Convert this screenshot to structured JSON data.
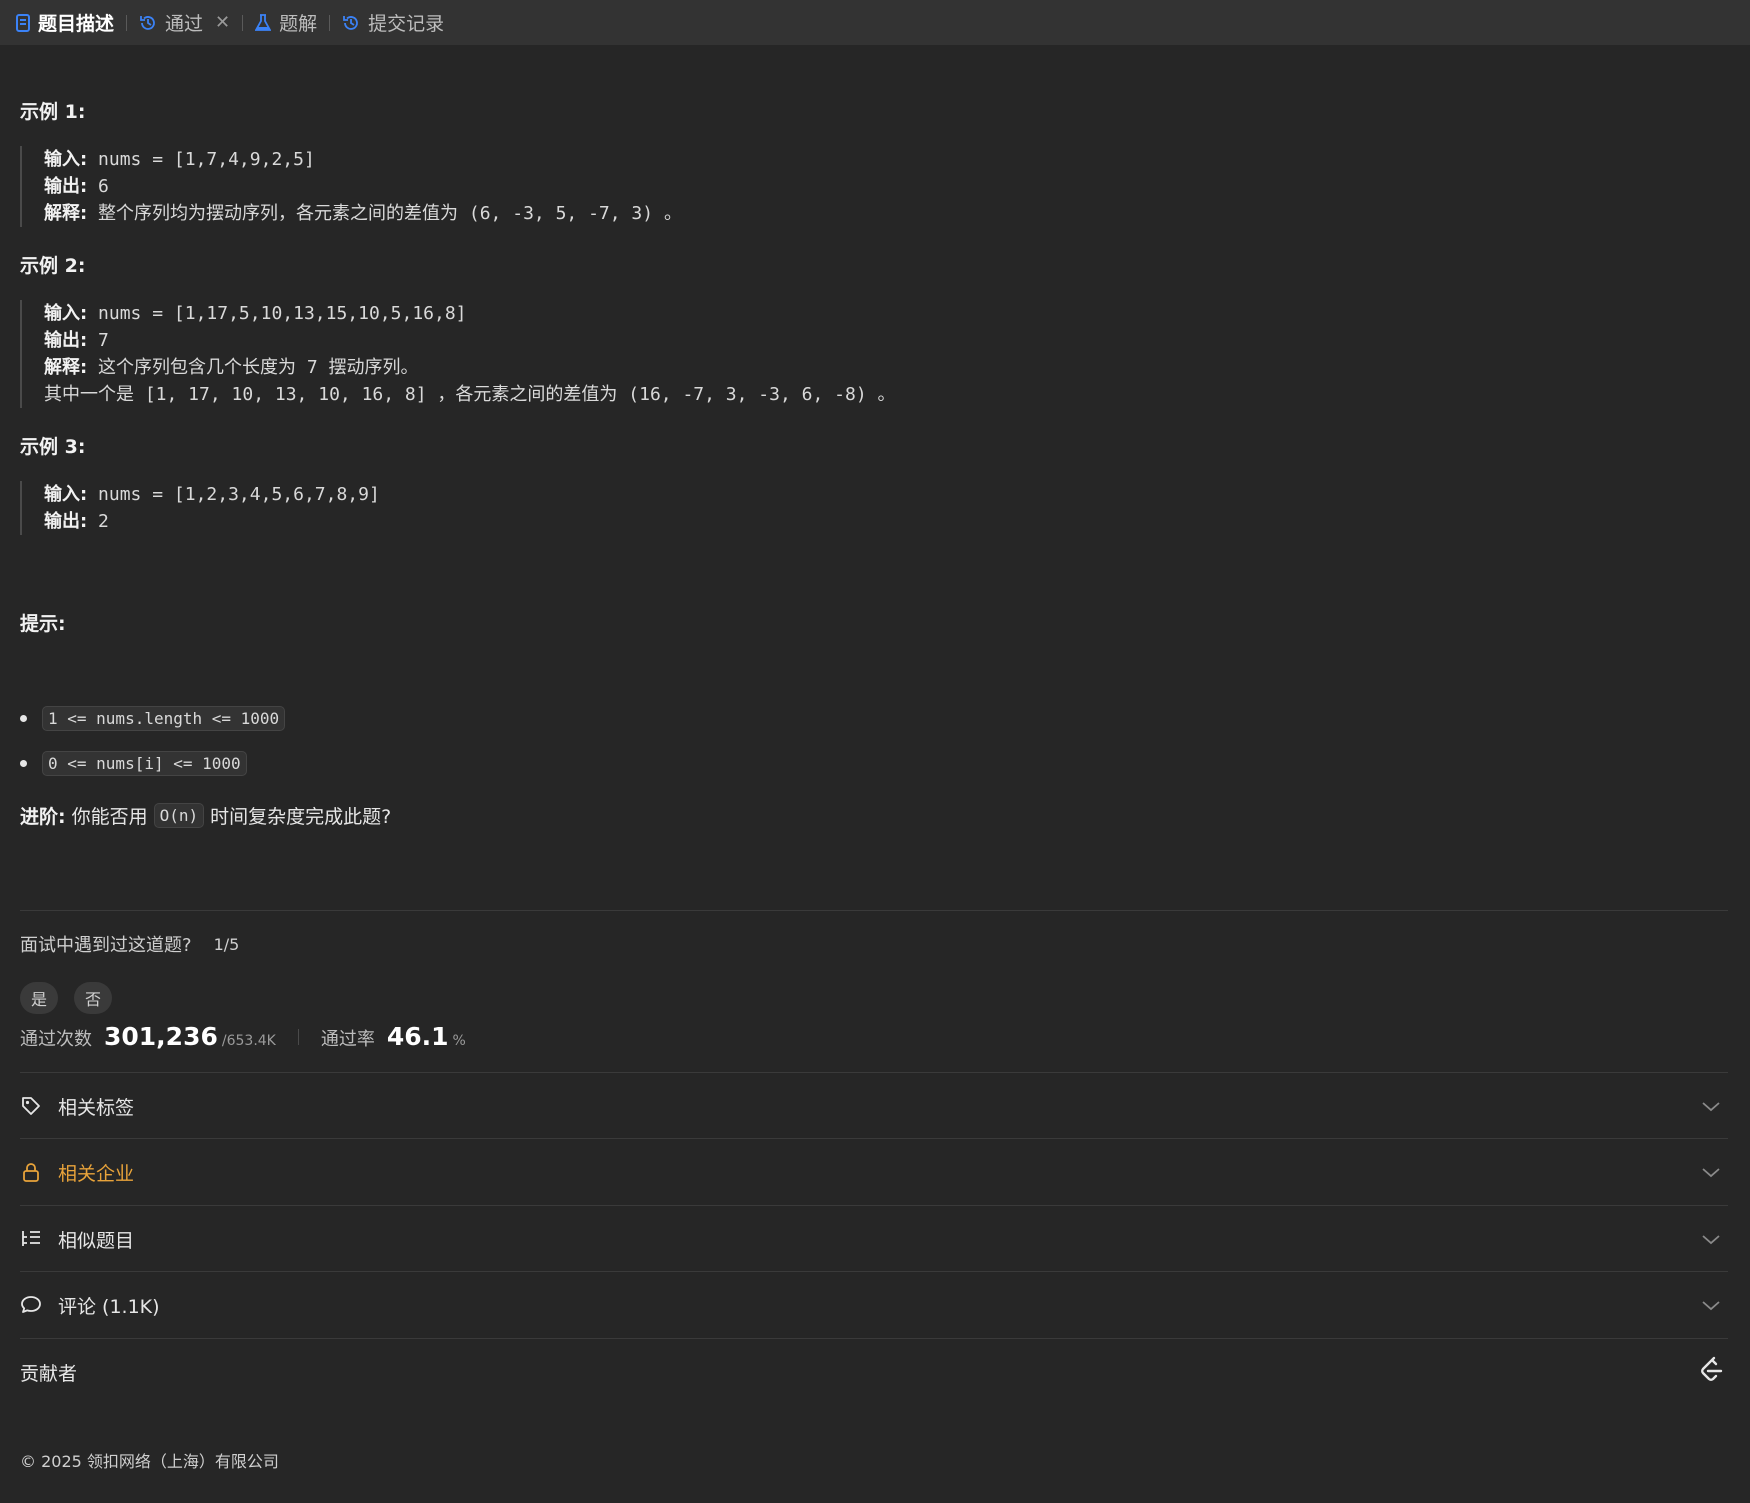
{
  "tabs": [
    {
      "label": "题目描述",
      "active": true
    },
    {
      "label": "通过",
      "closable": true
    },
    {
      "label": "题解"
    },
    {
      "label": "提交记录"
    }
  ],
  "examples": [
    {
      "title": "示例 1:",
      "input_label": "输入:",
      "input": "nums = [1,7,4,9,2,5]",
      "output_label": "输出:",
      "output": "6",
      "explain_label": "解释:",
      "explain": "整个序列均为摆动序列，各元素之间的差值为 (6, -3, 5, -7, 3) 。"
    },
    {
      "title": "示例 2:",
      "input_label": "输入:",
      "input": "nums = [1,17,5,10,13,15,10,5,16,8]",
      "output_label": "输出:",
      "output": "7",
      "explain_label": "解释:",
      "explain": "这个序列包含几个长度为 7 摆动序列。",
      "explain2": "其中一个是 [1, 17, 10, 13, 10, 16, 8] ，各元素之间的差值为 (16, -7, 3, -3, 6, -8) 。"
    },
    {
      "title": "示例 3:",
      "input_label": "输入:",
      "input": "nums = [1,2,3,4,5,6,7,8,9]",
      "output_label": "输出:",
      "output": "2"
    }
  ],
  "hints": {
    "title": "提示:",
    "items": [
      "1 <= nums.length <= 1000",
      "0 <= nums[i] <= 1000"
    ]
  },
  "advance": {
    "label": "进阶:",
    "before": "你能否用",
    "code": "O(n)",
    "after": "时间复杂度完成此题?"
  },
  "interview": {
    "question": "面试中遇到过这道题?",
    "count": "1/5",
    "yes": "是",
    "no": "否"
  },
  "stats": {
    "accepted_label": "通过次数",
    "accepted": "301,236",
    "submissions": "/653.4K",
    "rate_label": "通过率",
    "rate": "46.1",
    "rate_unit": "%"
  },
  "sections": [
    {
      "label": "相关标签",
      "icon": "tag-icon"
    },
    {
      "label": "相关企业",
      "icon": "lock-icon",
      "color": "#e8a33a"
    },
    {
      "label": "相似题目",
      "icon": "list-tree-icon"
    },
    {
      "label": "评论 (1.1K)",
      "icon": "comment-icon"
    }
  ],
  "contributors_label": "贡献者",
  "footer": "© 2025 领扣网络（上海）有限公司",
  "colors": {
    "accent": "#3b82f6",
    "lock": "#e8a33a",
    "bg": "#262626",
    "tabbar": "#333333"
  }
}
